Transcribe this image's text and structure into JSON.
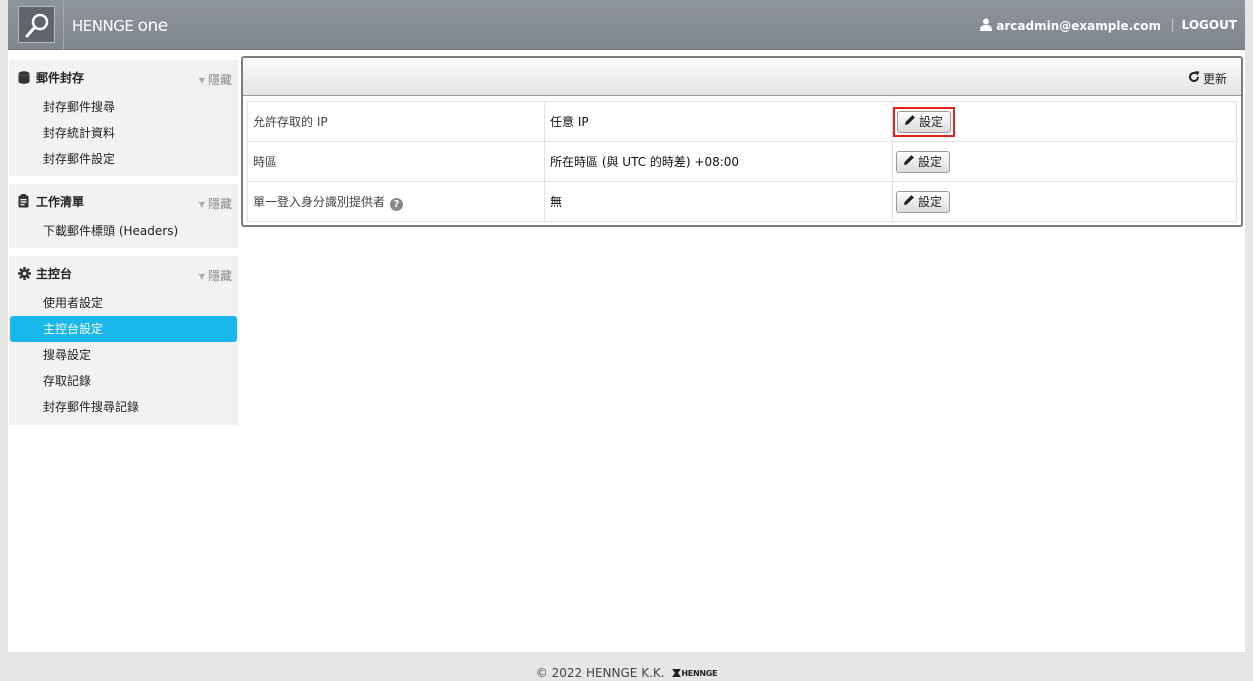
{
  "header": {
    "brand_main": "HENNGE ",
    "brand_one": "one",
    "user": "arcadmin@example.com",
    "logout": "LOGOUT"
  },
  "sidebar": {
    "hide_label": "隱藏",
    "sections": [
      {
        "title": "郵件封存",
        "icon": "database-icon",
        "items": [
          "封存郵件搜尋",
          "封存統計資料",
          "封存郵件設定"
        ]
      },
      {
        "title": "工作清單",
        "icon": "clipboard-icon",
        "items": [
          "下載郵件標頭 (Headers)"
        ]
      },
      {
        "title": "主控台",
        "icon": "gear-icon",
        "items": [
          "使用者設定",
          "主控台設定",
          "搜尋設定",
          "存取記錄",
          "封存郵件搜尋記錄"
        ],
        "active_index": 1
      }
    ]
  },
  "main": {
    "refresh_label": "更新",
    "rows": [
      {
        "label": "允許存取的 IP",
        "value": "任意 IP",
        "button": "設定"
      },
      {
        "label": "時區",
        "value": "所在時區 (與 UTC 的時差) +08:00",
        "button": "設定"
      },
      {
        "label": "單一登入身分識別提供者",
        "value": "無",
        "button": "設定"
      }
    ]
  },
  "footer": {
    "copyright": "© 2022 HENNGE K.K.",
    "logo_text": "HENNGE"
  }
}
